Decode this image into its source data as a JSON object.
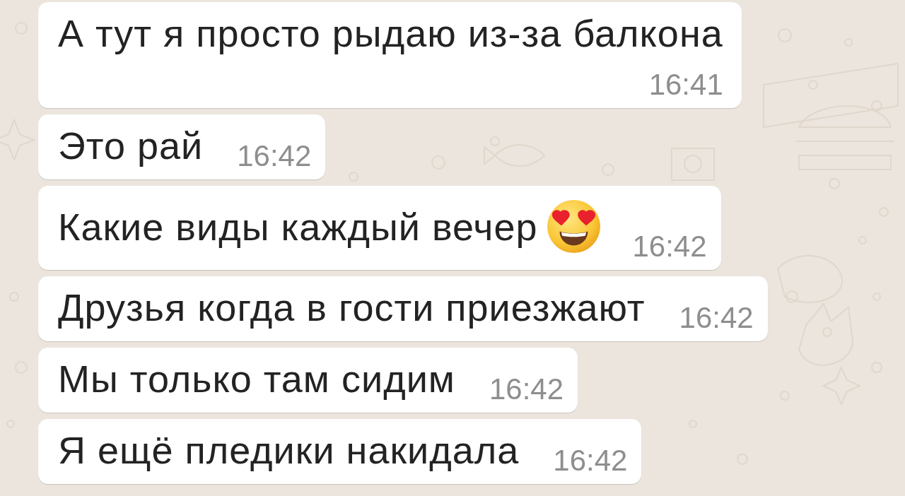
{
  "messages": [
    {
      "kind": "stacked",
      "text": "А тут я просто рыдаю из-за балкона",
      "time": "16:41"
    },
    {
      "kind": "inline",
      "text": "Это рай",
      "time": "16:42"
    },
    {
      "kind": "emoji",
      "text": "Какие виды каждый вечер",
      "time": "16:42"
    },
    {
      "kind": "inline",
      "text": "Друзья когда в гости приезжают",
      "time": "16:42"
    },
    {
      "kind": "inline",
      "text": "Мы только там сидим",
      "time": "16:42"
    },
    {
      "kind": "inline",
      "text": "Я ещё пледики накидала",
      "time": "16:42"
    }
  ]
}
